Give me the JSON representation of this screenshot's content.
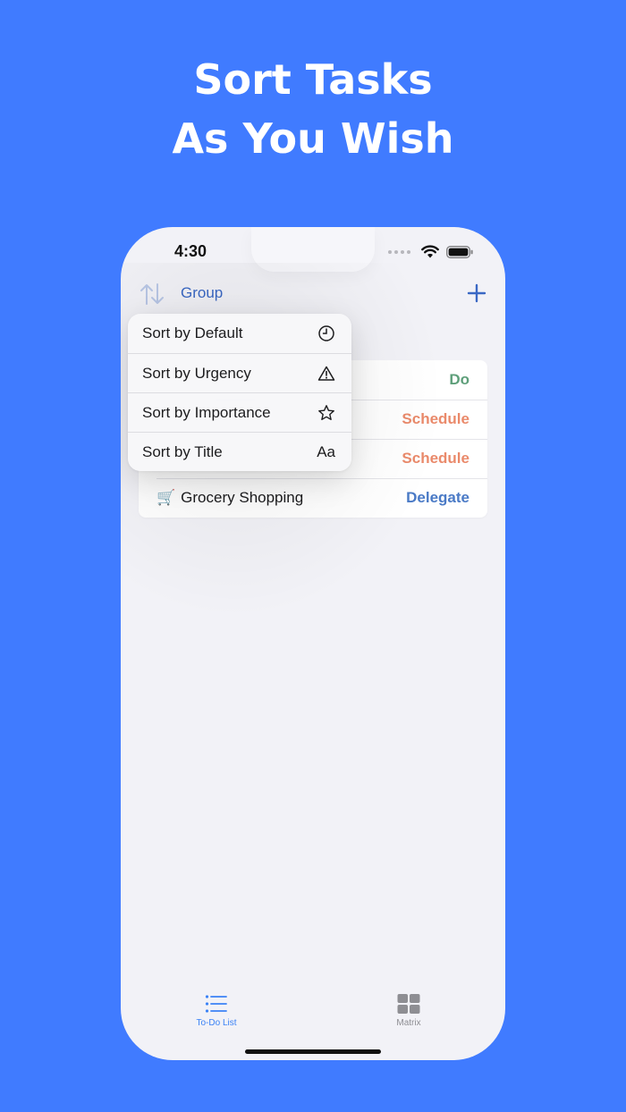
{
  "headline": {
    "line1": "Sort Tasks",
    "line2": "As You Wish"
  },
  "status_bar": {
    "time": "4:30"
  },
  "toolbar": {
    "group_label": "Group"
  },
  "sort_menu": {
    "items": [
      {
        "label": "Sort by Default",
        "icon": "clock-icon"
      },
      {
        "label": "Sort by Urgency",
        "icon": "warning-icon"
      },
      {
        "label": "Sort by Importance",
        "icon": "star-icon"
      },
      {
        "label": "Sort by Title",
        "icon": "text-aa-icon",
        "icon_text": "Aa"
      }
    ]
  },
  "task_list": {
    "rows": [
      {
        "title": "",
        "emoji": "",
        "tag": "Do",
        "tag_color": "#5e9f7a"
      },
      {
        "title": "",
        "emoji": "",
        "tag": "Schedule",
        "tag_color": "#ea8a6b"
      },
      {
        "title": "",
        "emoji": "",
        "tag": "Schedule",
        "tag_color": "#ea8a6b"
      },
      {
        "title": "Grocery Shopping",
        "emoji": "🛒",
        "tag": "Delegate",
        "tag_color": "#4a7ac6"
      }
    ]
  },
  "tab_bar": {
    "tabs": [
      {
        "label": "To-Do List",
        "active": true
      },
      {
        "label": "Matrix",
        "active": false
      }
    ]
  },
  "colors": {
    "background": "#407bff",
    "accent": "#3a68c4",
    "tab_active": "#3b82f6",
    "tab_inactive": "#8e8e93"
  }
}
